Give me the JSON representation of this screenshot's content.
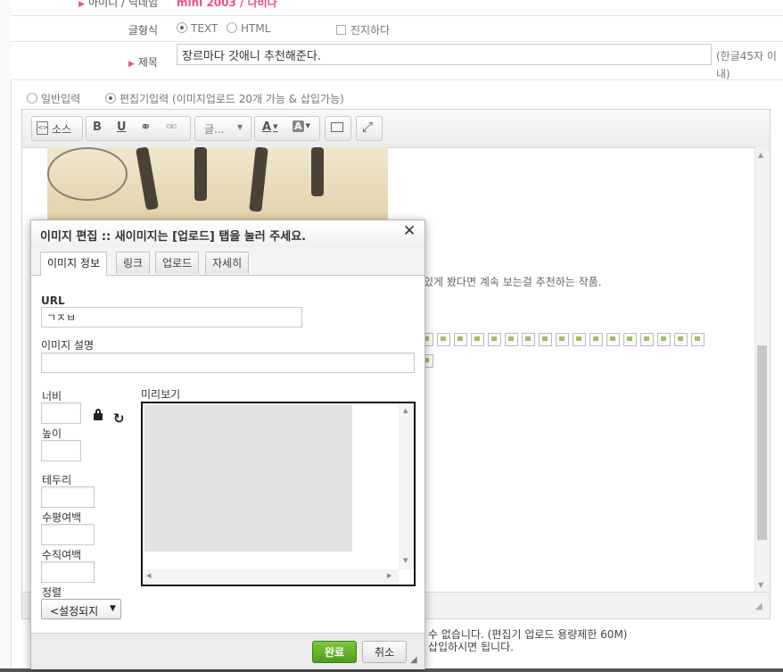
{
  "form": {
    "author_label": "아이디 / 닉네임",
    "author_value": "mini 2003 / 나비나",
    "format_label": "글형식",
    "format_text": "TEXT",
    "format_html": "HTML",
    "format_serious": "진지하다",
    "subject_label": "제목",
    "subject_value": "장르마다 갓애니 추천해준다.",
    "subject_hint": "(한글45자 이내)",
    "input_simple": "일반입력",
    "input_editor": "편집기입력 (이미지업로드 20개 가능 & 삽입가능)"
  },
  "toolbar": {
    "source_label": "소스",
    "bold_label": "B",
    "underline_label": "U",
    "font_label": "글...",
    "text_color_label": "A",
    "bg_color_label": "A"
  },
  "editor": {
    "body_text": "있게 봤다면 계속 보는걸 추천하는 작품."
  },
  "below": {
    "line1": "수 없습니다. (편집기 업로드 용량제한 60M)",
    "line2": "삽입하시면 됩니다."
  },
  "dialog": {
    "title": "이미지 편집 :: 새이미지는 [업로드] 탭을 눌러 주세요.",
    "tabs": [
      {
        "label": "이미지 정보"
      },
      {
        "label": "링크"
      },
      {
        "label": "업로드"
      },
      {
        "label": "자세히"
      }
    ],
    "url_label": "URL",
    "url_value": "ㄱㅈㅂ",
    "alt_label": "이미지 설명",
    "width_label": "너비",
    "height_label": "높이",
    "preview_label": "미리보기",
    "border_label": "테두리",
    "hspace_label": "수평여백",
    "vspace_label": "수직여백",
    "align_label": "정렬",
    "align_value": "<설정되지",
    "ok_label": "완료",
    "cancel_label": "취소"
  }
}
